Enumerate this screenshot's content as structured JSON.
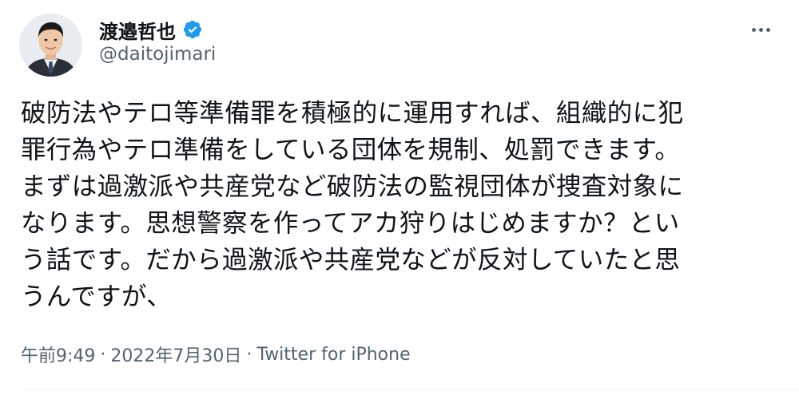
{
  "author": {
    "display_name": "渡邉哲也",
    "handle": "@daitojimari",
    "verified_icon": "verified-badge-icon",
    "verified_color": "#1d9bf0"
  },
  "more_icon": "more-horizontal-icon",
  "tweet": {
    "lines": [
      "破防法やテロ等準備罪を積極的に運用すれば、組織的に犯",
      "罪行為やテロ準備をしている団体を規制、処罰できます。",
      "まずは過激派や共産党など破防法の監視団体が捜査対象に",
      "なります。思想警察を作ってアカ狩りはじめますか？とい",
      "う話です。だから過激派や共産党などが反対していたと思",
      "うんですが、"
    ]
  },
  "meta": {
    "time": "午前9:49",
    "separator": "·",
    "date": "2022年7月30日",
    "source": "Twitter for iPhone"
  },
  "colors": {
    "text": "#0f1419",
    "secondary": "#536471",
    "divider": "#eff3f4"
  }
}
